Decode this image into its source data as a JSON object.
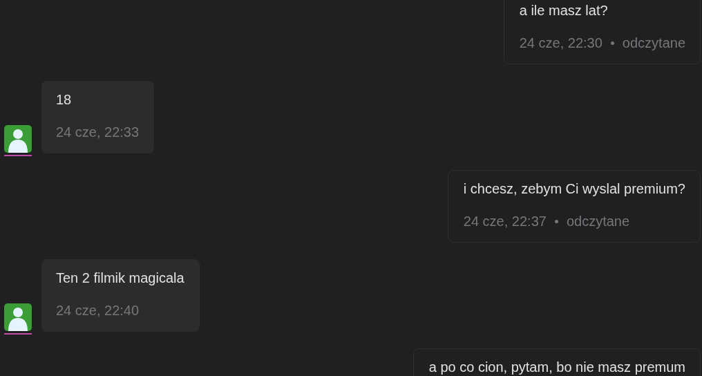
{
  "messages": [
    {
      "kind": "outgoing",
      "text": "a ile masz lat?",
      "time": "24 cze, 22:30",
      "status": "odczytane"
    },
    {
      "kind": "incoming",
      "text": "18",
      "time": "24 cze, 22:33"
    },
    {
      "kind": "outgoing",
      "text": "i chcesz, zebym Ci wyslal premium?",
      "time": "24 cze, 22:37",
      "status": "odczytane"
    },
    {
      "kind": "incoming",
      "text": "Ten 2 filmik magicala",
      "time": "24 cze, 22:40"
    },
    {
      "kind": "outgoing",
      "text": "a po co cion, pytam, bo nie masz premum"
    }
  ]
}
